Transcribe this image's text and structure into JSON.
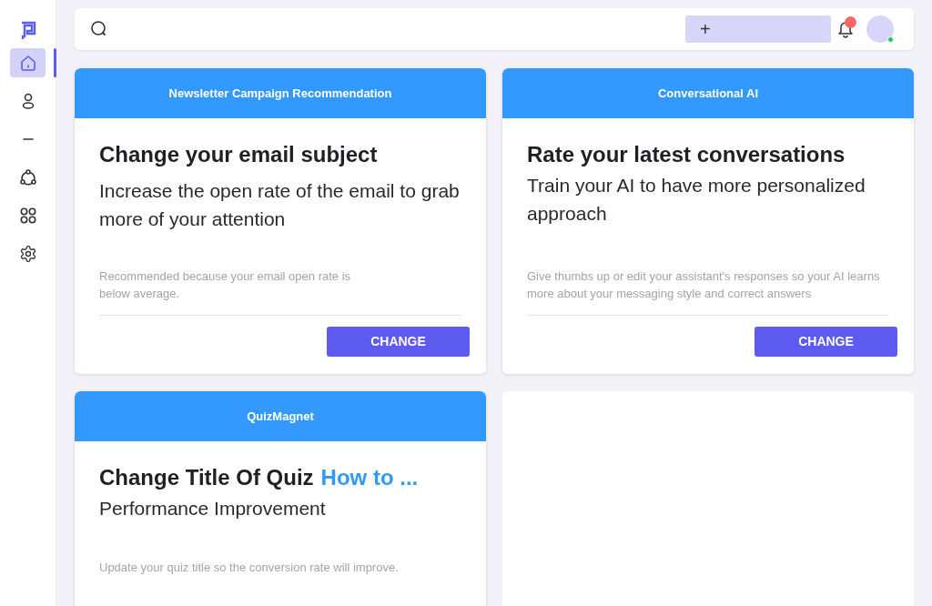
{
  "sidebar": {
    "items": [
      {
        "kind": "home",
        "selected": true
      },
      {
        "kind": "user",
        "selected": false
      },
      {
        "kind": "minus",
        "selected": false
      },
      {
        "kind": "network",
        "selected": false
      },
      {
        "kind": "grid",
        "selected": false
      },
      {
        "kind": "settings",
        "selected": false
      }
    ]
  },
  "header": {
    "add_button": "+",
    "notification": true,
    "online": true
  },
  "cards": [
    {
      "category": "Newsletter Campaign Recommendation",
      "title": "Change your email subject",
      "subtitle": "Increase the open rate of the email to grab more of your attention",
      "note": "Recommended because your email open rate is below average.",
      "button": "CHANGE"
    },
    {
      "category": "Conversational AI",
      "title": "Rate your latest conversations",
      "subtitle": "Train your AI to have more personalized approach",
      "note": "Give thumbs up or edit your assistant's responses so your AI learns more about your messaging style and correct answers",
      "button": "CHANGE"
    },
    {
      "category": "QuizMagnet",
      "title": "Change Title Of Quiz",
      "title_highlight": "How to ...",
      "subtitle": "Performance Improvement",
      "note": "Update your quiz title so the conversion rate will improve."
    }
  ]
}
